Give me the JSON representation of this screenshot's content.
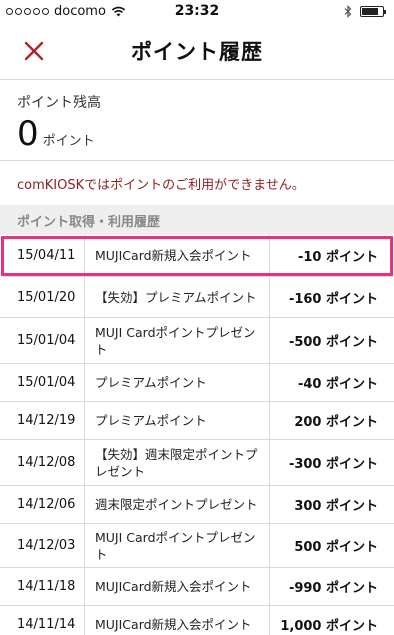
{
  "status_bar": {
    "carrier": "docomo",
    "time": "23:32",
    "battery_level": 0.8
  },
  "header": {
    "title": "ポイント履歴",
    "close_icon": "close-x-icon",
    "accent_color": "#b5212a"
  },
  "balance": {
    "label": "ポイント残高",
    "value": "0",
    "unit": "ポイント"
  },
  "notice": {
    "text": "comKIOSKではポイントのご利用ができません。",
    "color": "#8f1d1d"
  },
  "history": {
    "section_title": "ポイント取得・利用履歴",
    "rows": [
      {
        "date": "15/04/11",
        "description": "MUJICard新規入会ポイント",
        "points": "-10 ポイント",
        "highlighted": true
      },
      {
        "date": "15/01/20",
        "description": "【失効】プレミアムポイント",
        "points": "-160 ポイント"
      },
      {
        "date": "15/01/04",
        "description": "MUJI Cardポイントプレゼント",
        "points": "-500 ポイント"
      },
      {
        "date": "15/01/04",
        "description": "プレミアムポイント",
        "points": "-40 ポイント"
      },
      {
        "date": "14/12/19",
        "description": "プレミアムポイント",
        "points": "200 ポイント"
      },
      {
        "date": "14/12/08",
        "description": "【失効】週末限定ポイントプレゼント",
        "points": "-300 ポイント"
      },
      {
        "date": "14/12/06",
        "description": "週末限定ポイントプレゼント",
        "points": "300 ポイント"
      },
      {
        "date": "14/12/03",
        "description": "MUJI Cardポイントプレゼント",
        "points": "500 ポイント"
      },
      {
        "date": "14/11/18",
        "description": "MUJICard新規入会ポイント",
        "points": "-990 ポイント"
      },
      {
        "date": "14/11/14",
        "description": "MUJICard新規入会ポイント",
        "points": "1,000 ポイント"
      }
    ],
    "highlight_color": "#e8337c"
  }
}
